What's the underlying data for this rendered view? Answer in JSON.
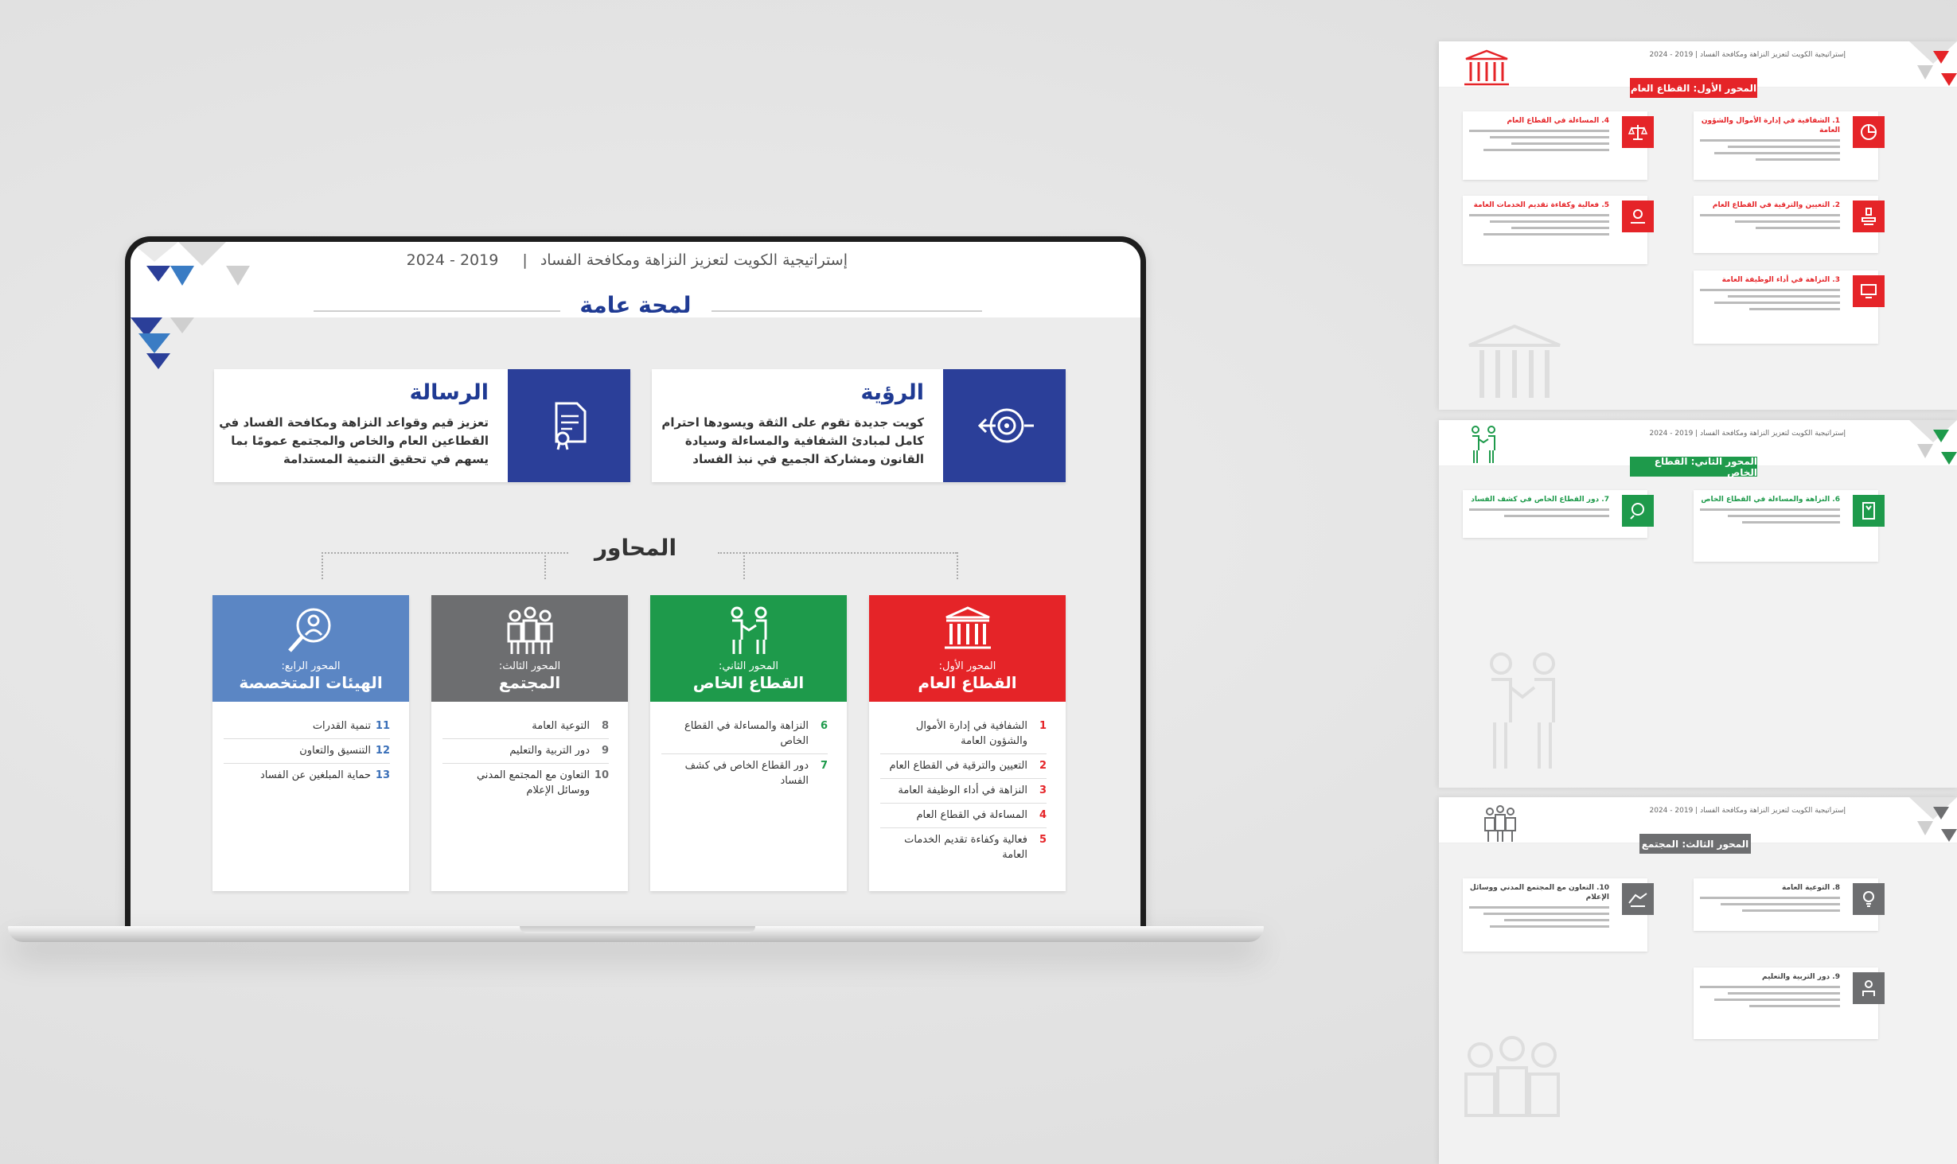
{
  "slide": {
    "header_text": "إستراتيجية الكويت لتعزيز النزاهة ومكافحة الفساد",
    "header_years": "2019 - 2024",
    "title": "لمحة عامة",
    "vision": {
      "title": "الرؤية",
      "text": "كويت جديدة تقوم على الثقة ويسودها احترام كامل لمبادئ الشفافية والمساءلة وسيادة القانون ومشاركة الجميع في نبذ الفساد"
    },
    "mission": {
      "title": "الرسالة",
      "text": "تعزيز قيم وقواعد النزاهة ومكافحة الفساد في القطاعين العام والخاص والمجتمع عمومًا بما يسهم في تحقيق التنمية المستدامة"
    },
    "axes_title": "المحاور",
    "axes": [
      {
        "sub": "المحور الأول:",
        "name": "القطاع العام",
        "color": "#e52428",
        "icon": "government-building-icon",
        "items": [
          {
            "num": "1",
            "text": "الشفافية في إدارة الأموال والشؤون العامة"
          },
          {
            "num": "2",
            "text": "التعيين والترقية في القطاع العام"
          },
          {
            "num": "3",
            "text": "النزاهة في أداء الوظيفة العامة"
          },
          {
            "num": "4",
            "text": "المساءلة في القطاع العام"
          },
          {
            "num": "5",
            "text": "فعالية وكفاءة تقديم الخدمات العامة"
          }
        ]
      },
      {
        "sub": "المحور الثاني:",
        "name": "القطاع الخاص",
        "color": "#1e9a4b",
        "icon": "handshake-icon",
        "items": [
          {
            "num": "6",
            "text": "النزاهة والمساءلة في القطاع الخاص"
          },
          {
            "num": "7",
            "text": "دور القطاع الخاص في كشف الفساد"
          }
        ]
      },
      {
        "sub": "المحور الثالث:",
        "name": "المجتمع",
        "color": "#6d6e70",
        "icon": "people-group-icon",
        "items": [
          {
            "num": "8",
            "text": "التوعية العامة"
          },
          {
            "num": "9",
            "text": "دور التربية والتعليم"
          },
          {
            "num": "10",
            "text": "التعاون مع المجتمع المدني ووسائل الإعلام"
          }
        ]
      },
      {
        "sub": "المحور الرابع:",
        "name": "الهيئات المتخصصة",
        "color": "#5b86c4",
        "icon": "search-person-icon",
        "items": [
          {
            "num": "11",
            "text": "تنمية القدرات"
          },
          {
            "num": "12",
            "text": "التنسيق والتعاون"
          },
          {
            "num": "13",
            "text": "حماية المبلغين عن الفساد"
          }
        ]
      }
    ]
  },
  "previews": {
    "header_text": "إستراتيجية الكويت لتعزيز النزاهة ومكافحة الفساد",
    "header_years": "2019 - 2024",
    "public": {
      "tag": "المحور الأول: القطاع العام",
      "color": "#e52428",
      "cards": [
        "1. الشفافية في إدارة الأموال والشؤون العامة",
        "4. المساءلة في القطاع العام",
        "2. التعيين والترقية في القطاع العام",
        "5. فعالية وكفاءة تقديم الخدمات العامة",
        "3. النزاهة في أداء الوظيفة العامة"
      ]
    },
    "private": {
      "tag": "المحور الثاني: القطاع الخاص",
      "color": "#1e9a4b",
      "cards": [
        "6. النزاهة والمساءلة في القطاع الخاص",
        "7. دور القطاع الخاص في كشف الفساد"
      ]
    },
    "society": {
      "tag": "المحور الثالث: المجتمع",
      "color": "#6d6e70",
      "cards": [
        "8. التوعية العامة",
        "10. التعاون مع المجتمع المدني ووسائل الإعلام",
        "9. دور التربية والتعليم"
      ]
    }
  }
}
